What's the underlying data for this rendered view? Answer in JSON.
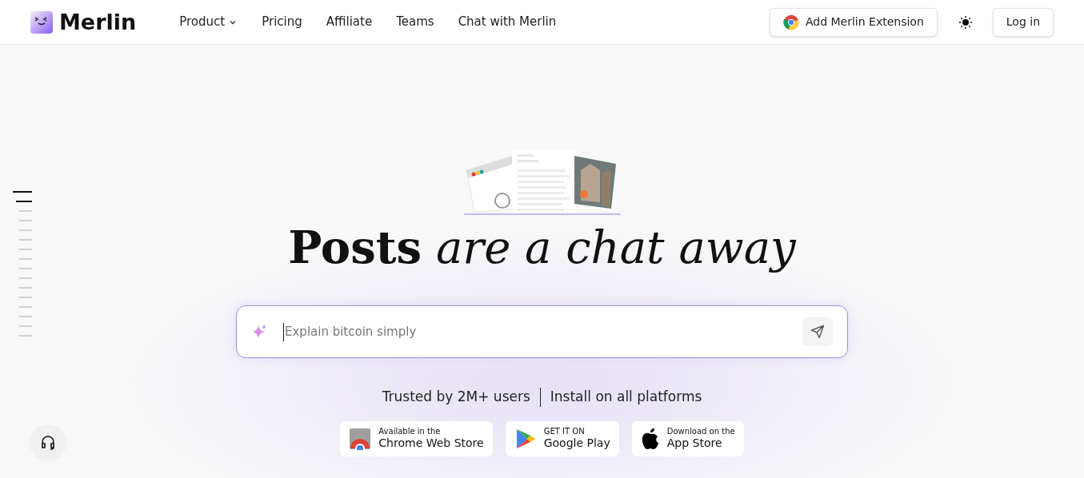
{
  "header": {
    "logo": "Merlin",
    "nav": [
      {
        "label": "Product",
        "has_menu": true
      },
      {
        "label": "Pricing",
        "has_menu": false
      },
      {
        "label": "Affiliate",
        "has_menu": false
      },
      {
        "label": "Teams",
        "has_menu": false
      },
      {
        "label": "Chat with Merlin",
        "has_menu": false
      }
    ],
    "extension_button": "Add Merlin Extension",
    "login_button": "Log in"
  },
  "section_marks": [
    {
      "selected": true
    },
    {
      "selected": true
    },
    {
      "selected": false
    },
    {
      "selected": false
    },
    {
      "selected": false
    },
    {
      "selected": false
    },
    {
      "selected": false
    },
    {
      "selected": false
    },
    {
      "selected": false
    },
    {
      "selected": false
    },
    {
      "selected": false
    },
    {
      "selected": false
    },
    {
      "selected": false
    },
    {
      "selected": false
    },
    {
      "selected": false
    },
    {
      "selected": false
    }
  ],
  "hero": {
    "headline": "**Posts** *are a chat away*",
    "prompt": {
      "placeholder": "Explain bitcoin simply"
    },
    "trusted": "Trusted by 2M+ users",
    "install": "Install on all platforms",
    "stores": [
      {
        "kind": "chrome",
        "small": "Available in the",
        "big": "Chrome Web Store"
      },
      {
        "kind": "play",
        "small": "GET IT ON",
        "big": "Google Play"
      },
      {
        "kind": "apple",
        "small": "Download on the",
        "big": "App Store"
      }
    ]
  }
}
